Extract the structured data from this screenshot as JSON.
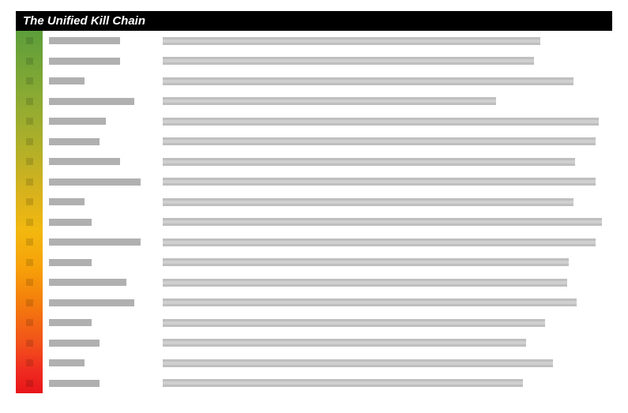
{
  "title": "The Unified Kill Chain",
  "rows": [
    {
      "phase": "",
      "description": ""
    },
    {
      "phase": "",
      "description": ""
    },
    {
      "phase": "",
      "description": ""
    },
    {
      "phase": "",
      "description": ""
    },
    {
      "phase": "",
      "description": ""
    },
    {
      "phase": "",
      "description": ""
    },
    {
      "phase": "",
      "description": ""
    },
    {
      "phase": "",
      "description": ""
    },
    {
      "phase": "",
      "description": ""
    },
    {
      "phase": "",
      "description": ""
    },
    {
      "phase": "",
      "description": ""
    },
    {
      "phase": "",
      "description": ""
    },
    {
      "phase": "",
      "description": ""
    },
    {
      "phase": "",
      "description": ""
    },
    {
      "phase": "",
      "description": ""
    },
    {
      "phase": "",
      "description": ""
    },
    {
      "phase": "",
      "description": ""
    },
    {
      "phase": "",
      "description": ""
    }
  ],
  "colors": {
    "header_background": "#000000",
    "header_text": "#ffffff",
    "gradient_top": "#5c9e3b",
    "gradient_bottom": "#e81619"
  }
}
